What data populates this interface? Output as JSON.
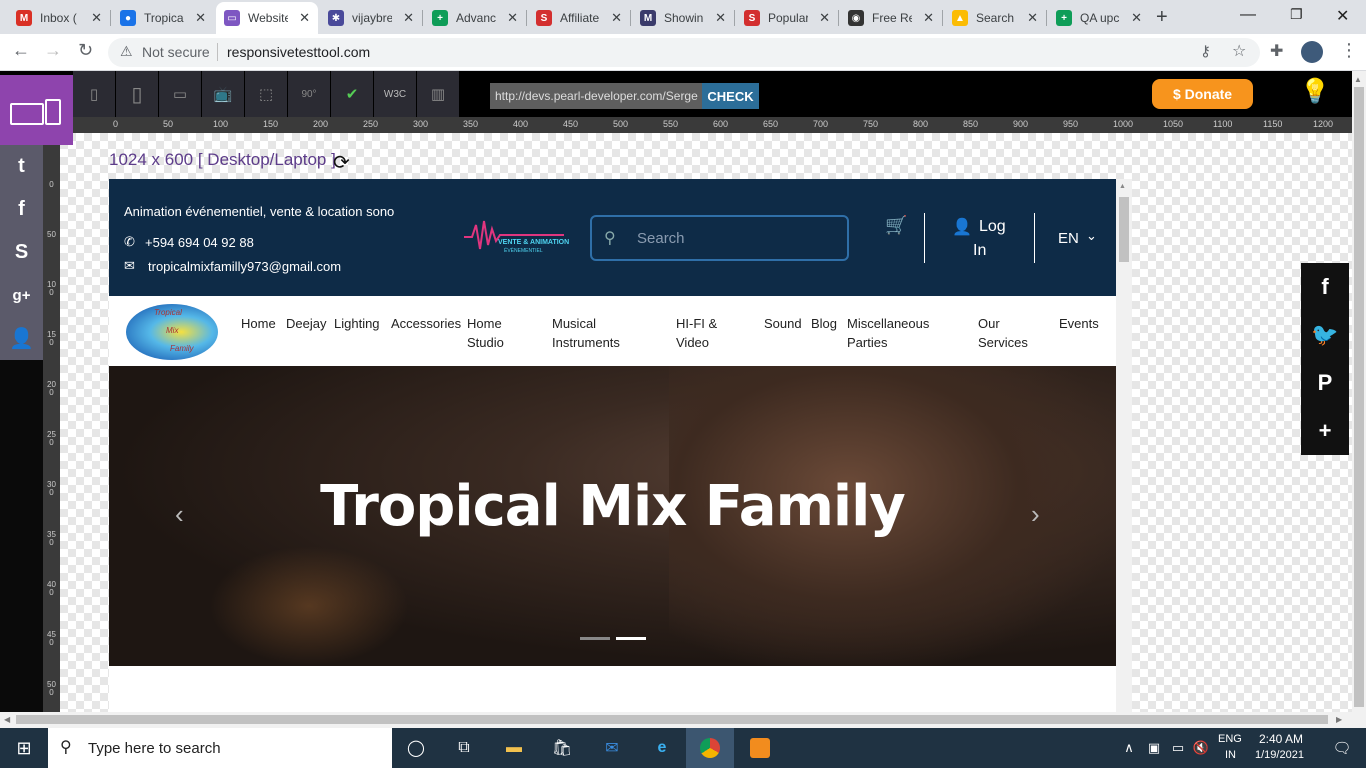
{
  "browser": {
    "tabs": [
      {
        "title": "Inbox (",
        "fav": "M",
        "color": "#d93025"
      },
      {
        "title": "Tropica",
        "fav": "●",
        "color": "#1a73e8"
      },
      {
        "title": "Website",
        "fav": "▭",
        "color": "#7e57c2"
      },
      {
        "title": "vijaybre",
        "fav": "✱",
        "color": "#4a4a9a"
      },
      {
        "title": "Advanc",
        "fav": "+",
        "color": "#0f9d58"
      },
      {
        "title": "Affiliate",
        "fav": "S",
        "color": "#d32f2f"
      },
      {
        "title": "Showin",
        "fav": "M",
        "color": "#3b3b6b"
      },
      {
        "title": "Popular",
        "fav": "S",
        "color": "#d32f2f"
      },
      {
        "title": "Free Re",
        "fav": "◉",
        "color": "#333333"
      },
      {
        "title": "Search",
        "fav": "▲",
        "color": "#fbbc04"
      },
      {
        "title": "QA upc",
        "fav": "+",
        "color": "#0f9d58"
      }
    ],
    "close_glyph": "✕",
    "new_tab_glyph": "+",
    "not_secure": "Not secure",
    "url": "responsivetesttool.com"
  },
  "tool": {
    "url_input": "http://devs.pearl-developer.com/Serge",
    "check_label": "CHECK",
    "donate_label": "$ Donate",
    "device_label": "1024 x 600 [ Desktop/Laptop ]",
    "w3c_label": "W3C",
    "rotate_label": "90°",
    "ruler": [
      "0",
      "50",
      "100",
      "150",
      "200",
      "250",
      "300",
      "350",
      "400",
      "450",
      "500",
      "550",
      "600",
      "650",
      "700",
      "750",
      "800",
      "850",
      "900",
      "950",
      "1000",
      "1050",
      "1100",
      "1150",
      "1200"
    ],
    "vruler": [
      "0",
      "50",
      "100",
      "150",
      "200",
      "250",
      "300",
      "350",
      "400",
      "450",
      "500"
    ]
  },
  "site": {
    "tagline": "Animation événementiel, vente & location sono",
    "phone": "+594 694 04 92 88",
    "email": "tropicalmixfamilly973@gmail.com",
    "search_placeholder": "Search",
    "login_1": "Log",
    "login_2": "In",
    "lang": "EN",
    "logo_text": "VENTE & ANIMATION",
    "logo_sub": "ÉVÈNEMENTIEL",
    "badge_line1": "Tropical",
    "badge_line2": "Mix",
    "badge_line3": "Family",
    "nav": [
      {
        "l1": "Home",
        "l2": ""
      },
      {
        "l1": "Deejay",
        "l2": ""
      },
      {
        "l1": "Lighting",
        "l2": ""
      },
      {
        "l1": "Accessories",
        "l2": ""
      },
      {
        "l1": "Home",
        "l2": "Studio"
      },
      {
        "l1": "Musical",
        "l2": "Instruments"
      },
      {
        "l1": "HI-FI &",
        "l2": "Video"
      },
      {
        "l1": "Sound",
        "l2": ""
      },
      {
        "l1": "Blog",
        "l2": ""
      },
      {
        "l1": "Miscellaneous",
        "l2": "Parties"
      },
      {
        "l1": "Our",
        "l2": "Services"
      },
      {
        "l1": "Events",
        "l2": ""
      }
    ],
    "hero_title": "Tropical Mix Family",
    "slide_index": 2,
    "slide_count": 2
  },
  "taskbar": {
    "search_placeholder": "Type here to search",
    "lang1": "ENG",
    "lang2": "IN",
    "time": "2:40 AM",
    "date": "1/19/2021"
  },
  "colors": {
    "site_header": "#0e2b47",
    "tool_purple": "#8e44ad",
    "donate": "#f7941d",
    "check": "#2c6e99"
  }
}
